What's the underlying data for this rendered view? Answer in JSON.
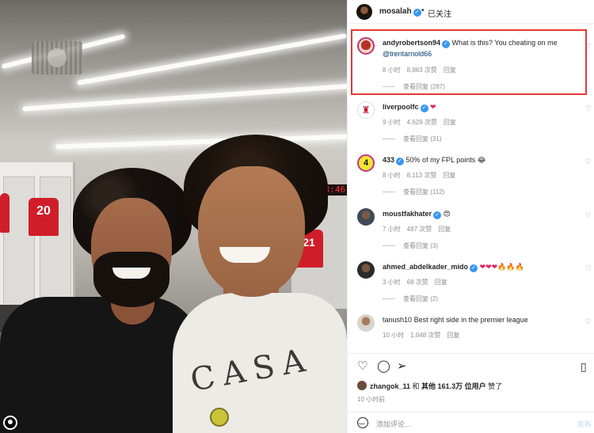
{
  "post": {
    "author": "mosalah",
    "follow_status": "已关注",
    "separator": "•"
  },
  "photo": {
    "clock_text": "13:46",
    "jersey_left_number": "20",
    "jersey_right_number": "21",
    "shirt_text": "CASA"
  },
  "comments": [
    {
      "user": "andyrobertson94",
      "verified": true,
      "text": "What is this? You cheating on me",
      "mention": "@trentarnold66",
      "time": "8 小时",
      "likes": "8,863 次赞",
      "reply": "回复",
      "view_replies": "查看回复 (287)",
      "highlighted": true
    },
    {
      "user": "liverpoolfc",
      "verified": true,
      "text": "❤",
      "time": "9 小时",
      "likes": "4,629 次赞",
      "reply": "回复",
      "view_replies": "查看回复 (31)"
    },
    {
      "user": "433",
      "verified": true,
      "text": "50% of my FPL points 😂",
      "time": "8 小时",
      "likes": "8,113 次赞",
      "reply": "回复",
      "view_replies": "查看回复 (112)"
    },
    {
      "user": "moustfakhater",
      "verified": true,
      "text": "😍",
      "time": "7 小时",
      "likes": "487 次赞",
      "reply": "回复",
      "view_replies": "查看回复 (3)"
    },
    {
      "user": "ahmed_abdelkader_mido",
      "verified": true,
      "text": "❤❤❤🔥🔥🔥",
      "time": "3 小时",
      "likes": "68 次赞",
      "reply": "回复",
      "view_replies": "查看回复 (2)"
    },
    {
      "user": "tanush10",
      "verified": false,
      "text": "Best right side in the premier league",
      "time": "10 小时",
      "likes": "1,048 次赞",
      "reply": "回复"
    }
  ],
  "likes_line": {
    "user": "zhangok_11",
    "middle": " 和 ",
    "others": "其他 161.3万 位用户",
    "suffix": " 赞了"
  },
  "time_ago": "10 小时前",
  "add_comment": {
    "placeholder": "添加评论...",
    "post_label": "发布"
  },
  "colors": {
    "highlight_border": "#e53935",
    "verified_blue": "#3897f0",
    "mention_blue": "#00376b",
    "meta_gray": "#8e8e8e"
  }
}
